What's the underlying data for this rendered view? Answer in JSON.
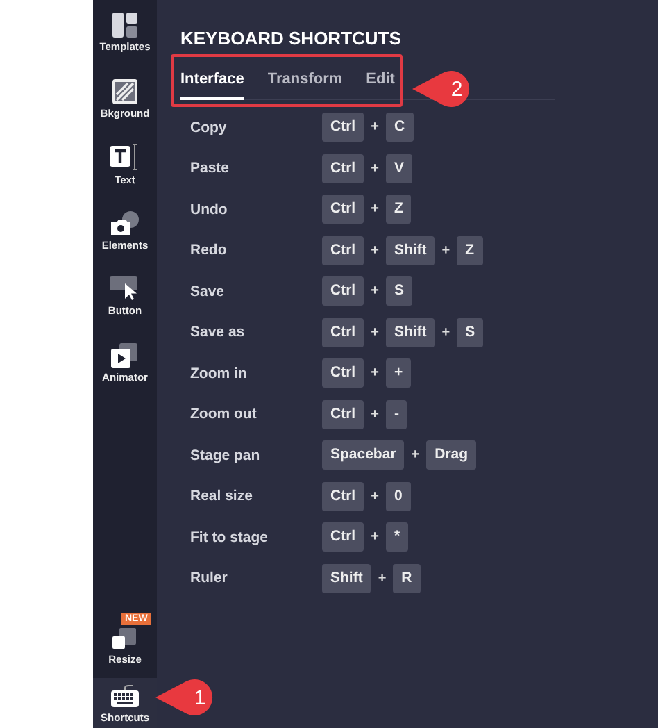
{
  "sidebar": {
    "items": [
      {
        "label": "Templates",
        "selected": false
      },
      {
        "label": "Bkground",
        "selected": false
      },
      {
        "label": "Text",
        "selected": false
      },
      {
        "label": "Elements",
        "selected": false
      },
      {
        "label": "Button",
        "selected": false
      },
      {
        "label": "Animator",
        "selected": false
      },
      {
        "label": "Resize",
        "selected": false,
        "badge": "NEW"
      },
      {
        "label": "Shortcuts",
        "selected": true
      }
    ]
  },
  "panel": {
    "title": "KEYBOARD SHORTCUTS",
    "tabs": [
      {
        "label": "Interface",
        "selected": true
      },
      {
        "label": "Transform",
        "selected": false
      },
      {
        "label": "Edit",
        "selected": false
      }
    ],
    "shortcuts": [
      {
        "action": "Copy",
        "keys": [
          "Ctrl",
          "+",
          "C"
        ]
      },
      {
        "action": "Paste",
        "keys": [
          "Ctrl",
          "+",
          "V"
        ]
      },
      {
        "action": "Undo",
        "keys": [
          "Ctrl",
          "+",
          "Z"
        ]
      },
      {
        "action": "Redo",
        "keys": [
          "Ctrl",
          "+",
          "Shift",
          "+",
          "Z"
        ]
      },
      {
        "action": "Save",
        "keys": [
          "Ctrl",
          "+",
          "S"
        ]
      },
      {
        "action": "Save as",
        "keys": [
          "Ctrl",
          "+",
          "Shift",
          "+",
          "S"
        ]
      },
      {
        "action": "Zoom in",
        "keys": [
          "Ctrl",
          "+",
          "+"
        ]
      },
      {
        "action": "Zoom out",
        "keys": [
          "Ctrl",
          "+",
          "-"
        ]
      },
      {
        "action": "Stage pan",
        "keys": [
          "Spacebar",
          "+",
          "Drag"
        ]
      },
      {
        "action": "Real size",
        "keys": [
          "Ctrl",
          "+",
          "0"
        ]
      },
      {
        "action": "Fit to stage",
        "keys": [
          "Ctrl",
          "+",
          "*"
        ]
      },
      {
        "action": "Ruler",
        "keys": [
          "Shift",
          "+",
          "R"
        ]
      }
    ]
  },
  "annotations": [
    {
      "number": "1"
    },
    {
      "number": "2"
    }
  ]
}
